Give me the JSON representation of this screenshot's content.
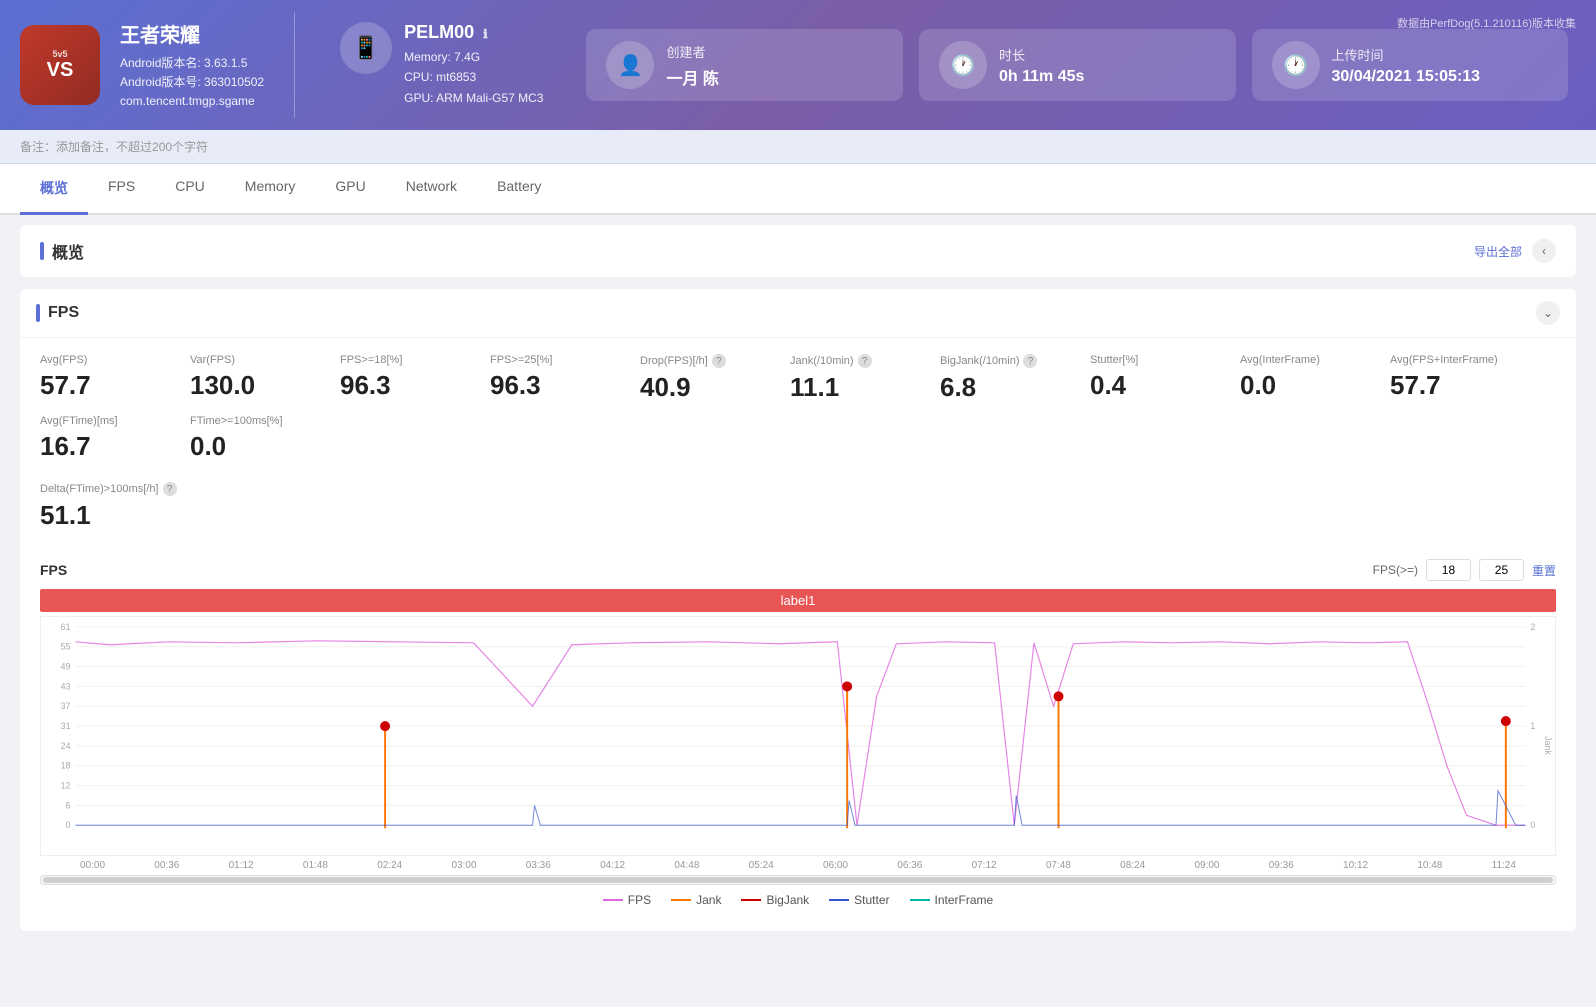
{
  "perfdog": {
    "version_note": "数据由PerfDog(5.1.210116)版本收集"
  },
  "app": {
    "name": "王者荣耀",
    "android_version": "Android版本名: 3.63.1.5",
    "android_code": "Android版本号: 363010502",
    "package": "com.tencent.tmgp.sgame",
    "icon_text": "VS"
  },
  "device": {
    "id": "PELM00",
    "memory": "Memory: 7.4G",
    "cpu": "CPU: mt6853",
    "gpu": "GPU: ARM Mali-G57 MC3"
  },
  "creator": {
    "label": "创建者",
    "value": "一月 陈"
  },
  "duration": {
    "label": "时长",
    "value": "0h 11m 45s"
  },
  "upload_time": {
    "label": "上传时间",
    "value": "30/04/2021 15:05:13"
  },
  "notes_bar": {
    "prefix": "备注：",
    "placeholder": "添加备注，不超过200个字符"
  },
  "nav_tabs": [
    {
      "id": "overview",
      "label": "概览",
      "active": true
    },
    {
      "id": "fps",
      "label": "FPS",
      "active": false
    },
    {
      "id": "cpu",
      "label": "CPU",
      "active": false
    },
    {
      "id": "memory",
      "label": "Memory",
      "active": false
    },
    {
      "id": "gpu",
      "label": "GPU",
      "active": false
    },
    {
      "id": "network",
      "label": "Network",
      "active": false
    },
    {
      "id": "battery",
      "label": "Battery",
      "active": false
    }
  ],
  "overview_section": {
    "title": "概览",
    "export_label": "导出全部"
  },
  "fps_section": {
    "title": "FPS",
    "stats": [
      {
        "label": "Avg(FPS)",
        "value": "57.7",
        "has_help": false
      },
      {
        "label": "Var(FPS)",
        "value": "130.0",
        "has_help": false
      },
      {
        "label": "FPS>=18[%]",
        "value": "96.3",
        "has_help": false
      },
      {
        "label": "FPS>=25[%]",
        "value": "96.3",
        "has_help": false
      },
      {
        "label": "Drop(FPS)[/h]",
        "value": "40.9",
        "has_help": true
      },
      {
        "label": "Jank(/10min)",
        "value": "11.1",
        "has_help": true
      },
      {
        "label": "BigJank(/10min)",
        "value": "6.8",
        "has_help": true
      },
      {
        "label": "Stutter[%]",
        "value": "0.4",
        "has_help": false
      },
      {
        "label": "Avg(InterFrame)",
        "value": "0.0",
        "has_help": false
      },
      {
        "label": "Avg(FPS+InterFrame)",
        "value": "57.7",
        "has_help": false
      },
      {
        "label": "Avg(FTime)[ms]",
        "value": "16.7",
        "has_help": false
      },
      {
        "label": "FTime>=100ms[%]",
        "value": "0.0",
        "has_help": false
      }
    ],
    "delta_label": "Delta(FTime)>100ms[/h]",
    "delta_value": "51.1",
    "delta_has_help": true,
    "chart_title": "FPS",
    "fps_filter_label": "FPS(>=)",
    "fps_val1": "18",
    "fps_val2": "25",
    "reset_label": "重置",
    "chart_label": "label1"
  },
  "chart": {
    "y_labels_left": [
      "61",
      "55",
      "49",
      "43",
      "37",
      "31",
      "24",
      "18",
      "12",
      "6",
      "0"
    ],
    "y_labels_right": [
      "2",
      "1",
      "0"
    ],
    "x_labels": [
      "00:00",
      "00:36",
      "01:12",
      "01:48",
      "02:24",
      "03:00",
      "03:36",
      "04:12",
      "04:48",
      "05:24",
      "06:00",
      "06:36",
      "07:12",
      "07:48",
      "08:24",
      "09:00",
      "09:36",
      "10:12",
      "10:48",
      "11:24"
    ],
    "legend": [
      {
        "name": "FPS",
        "color": "#e066e0",
        "type": "line"
      },
      {
        "name": "Jank",
        "color": "#ff7700",
        "type": "line"
      },
      {
        "name": "BigJank",
        "color": "#cc0000",
        "type": "line"
      },
      {
        "name": "Stutter",
        "color": "#3355cc",
        "type": "line"
      },
      {
        "name": "InterFrame",
        "color": "#00bbaa",
        "type": "line"
      }
    ]
  }
}
